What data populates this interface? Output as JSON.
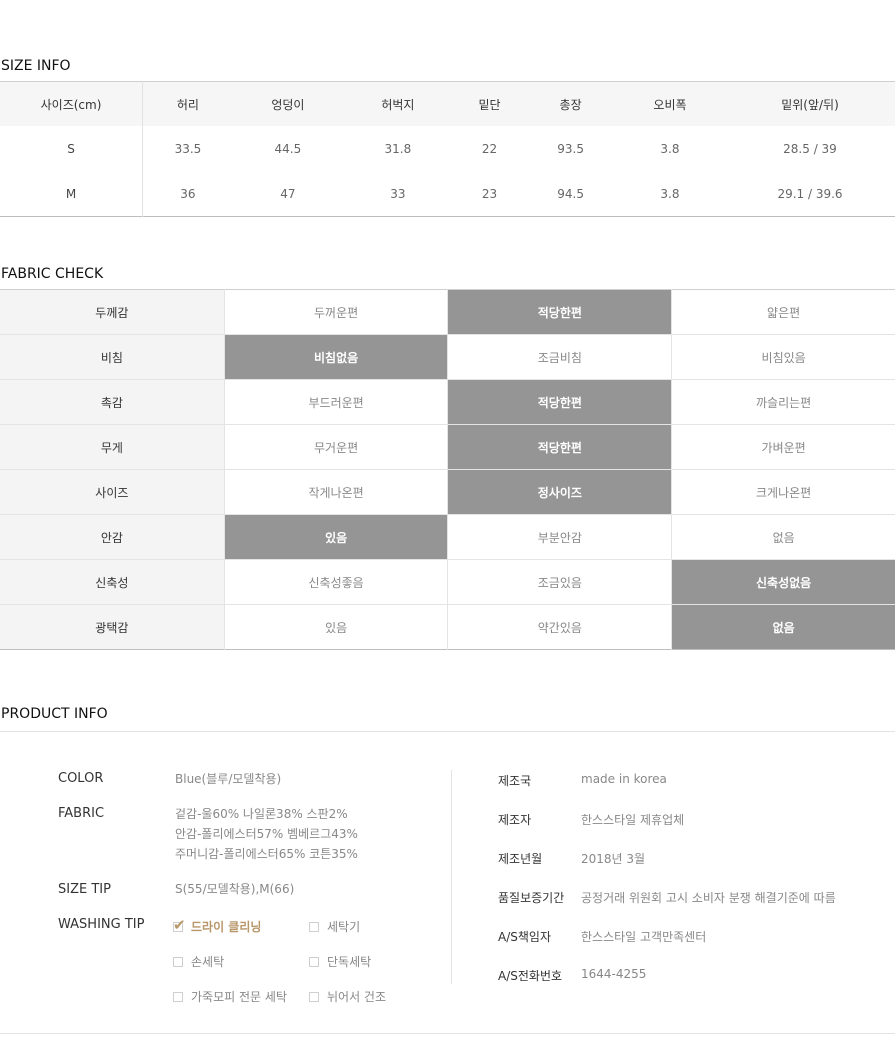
{
  "size_info": {
    "title": "SIZE INFO",
    "headers": [
      "사이즈(cm)",
      "허리",
      "엉덩이",
      "허벅지",
      "밑단",
      "총장",
      "오비폭",
      "밑위(앞/뒤)"
    ],
    "rows": [
      [
        "S",
        "33.5",
        "44.5",
        "31.8",
        "22",
        "93.5",
        "3.8",
        "28.5 / 39"
      ],
      [
        "M",
        "36",
        "47",
        "33",
        "23",
        "94.5",
        "3.8",
        "29.1 / 39.6"
      ]
    ]
  },
  "fabric_check": {
    "title": "FABRIC CHECK",
    "rows": [
      {
        "label": "두께감",
        "options": [
          "두꺼운편",
          "적당한편",
          "얇은편"
        ],
        "selected": 1
      },
      {
        "label": "비침",
        "options": [
          "비침없음",
          "조금비침",
          "비침있음"
        ],
        "selected": 0
      },
      {
        "label": "촉감",
        "options": [
          "부드러운편",
          "적당한편",
          "까슬리는편"
        ],
        "selected": 1
      },
      {
        "label": "무게",
        "options": [
          "무거운편",
          "적당한편",
          "가벼운편"
        ],
        "selected": 1
      },
      {
        "label": "사이즈",
        "options": [
          "작게나온편",
          "정사이즈",
          "크게나온편"
        ],
        "selected": 1
      },
      {
        "label": "안감",
        "options": [
          "있음",
          "부분안감",
          "없음"
        ],
        "selected": 0
      },
      {
        "label": "신축성",
        "options": [
          "신축성좋음",
          "조금있음",
          "신축성없음"
        ],
        "selected": 2
      },
      {
        "label": "광택감",
        "options": [
          "있음",
          "약간있음",
          "없음"
        ],
        "selected": 2
      }
    ]
  },
  "product_info": {
    "title": "PRODUCT INFO",
    "color_label": "COLOR",
    "color_value": "Blue(블루/모델착용)",
    "fabric_label": "FABRIC",
    "fabric_lines": [
      "겉감-울60% 나일론38% 스판2%",
      "안감-폴리에스터57% 벰베르그43%",
      "주머니감-폴리에스터65% 코튼35%"
    ],
    "size_tip_label": "SIZE TIP",
    "size_tip_value": "S(55/모델착용),M(66)",
    "washing_label": "WASHING TIP",
    "washing": [
      {
        "label": "드라이 클리닝",
        "checked": true
      },
      {
        "label": "세탁기",
        "checked": false
      },
      {
        "label": "손세탁",
        "checked": false
      },
      {
        "label": "단독세탁",
        "checked": false
      },
      {
        "label": "가죽모피 전문 세탁",
        "checked": false
      },
      {
        "label": "뉘어서 건조",
        "checked": false
      }
    ],
    "right": [
      {
        "label": "제조국",
        "value": "made in korea"
      },
      {
        "label": "제조자",
        "value": "한스스타일 제휴업체"
      },
      {
        "label": "제조년월",
        "value": "2018년 3월"
      },
      {
        "label": "품질보증기간",
        "value": "공정거래 위원회 고시 소비자 분쟁 해결기준에 따름"
      },
      {
        "label": "A/S책임자",
        "value": "한스스타일 고객만족센터"
      },
      {
        "label": "A/S전화번호",
        "value": "1644-4255"
      }
    ]
  },
  "colors": {
    "selected_bg": "#959595",
    "accent": "#b8976a"
  }
}
